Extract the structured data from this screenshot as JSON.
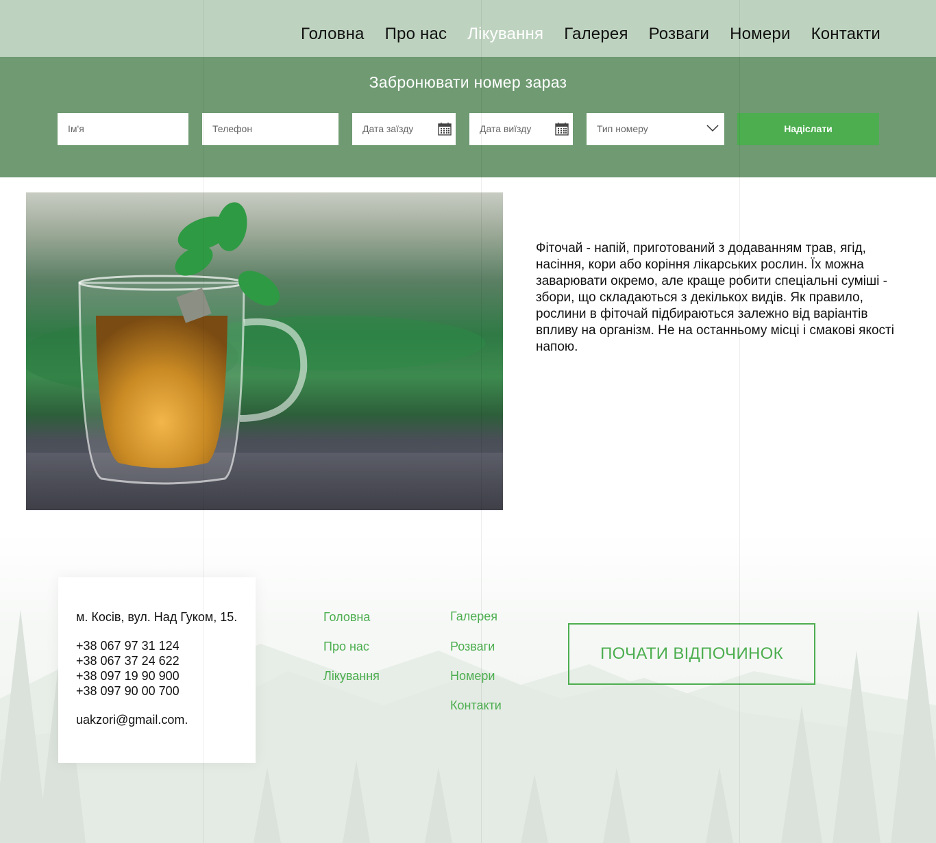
{
  "nav": {
    "items": [
      {
        "label": "Головна",
        "active": false
      },
      {
        "label": "Про нас",
        "active": false
      },
      {
        "label": "Лікування",
        "active": true
      },
      {
        "label": "Галерея",
        "active": false
      },
      {
        "label": "Розваги",
        "active": false
      },
      {
        "label": "Номери",
        "active": false
      },
      {
        "label": "Контакти",
        "active": false
      }
    ]
  },
  "booking": {
    "title": "Забронювати номер зараз",
    "name_placeholder": "Ім'я",
    "phone_placeholder": "Телефон",
    "checkin_placeholder": "Дата заїзду",
    "checkout_placeholder": "Дата виїзду",
    "room_type_placeholder": "Тип номеру",
    "submit_label": "Надіслати"
  },
  "content": {
    "description": "Фіточай - напій, приготований з додаванням трав, ягід, насіння, кори або коріння лікарських рослин. Їх можна заварювати окремо, але краще робити спеціальні суміші - збори, що складаються з декількох видів. Як правило, рослини в фіточай підбираються залежно від варіантів впливу на організм. Не на останньому місці і смакові якості напою."
  },
  "footer": {
    "address": "м. Косів, вул. Над Гуком, 15.",
    "phones": [
      "+38 067 97 31 124",
      "+38 067 37 24 622",
      "+38 097 19 90 900",
      "+38 097 90 00 700"
    ],
    "email": "uakzori@gmail.com.",
    "links_col1": [
      "Головна",
      "Про нас",
      "Лікування"
    ],
    "links_col2": [
      "Галерея",
      "Розваги",
      "Номери",
      "Контакти"
    ],
    "cta_label": "ПОЧАТИ ВІДПОЧИНОК"
  },
  "colors": {
    "header_bg": "#bed3bf",
    "booking_bg": "#6f9a72",
    "accent_green": "#4cae4f"
  }
}
